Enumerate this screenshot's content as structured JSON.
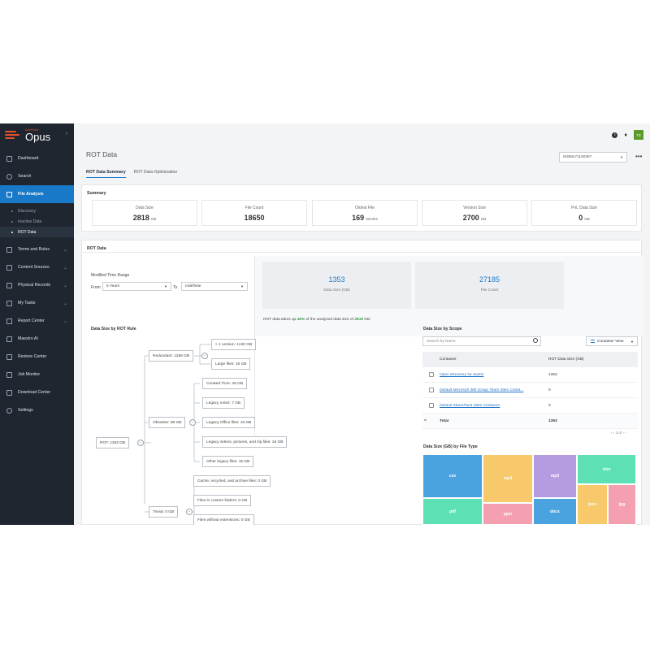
{
  "app": {
    "brand_small": "AvePoint",
    "brand_name": "Opus",
    "collapse_glyph": "‹",
    "avatar_initials": "TZ",
    "icons": [
      "info-icon",
      "bell-icon"
    ]
  },
  "sidebar": {
    "items": [
      {
        "label": "Dashboard",
        "icon": "dashboard-icon"
      },
      {
        "label": "Search",
        "icon": "search-icon"
      },
      {
        "label": "File Analysis",
        "icon": "file-analysis-icon"
      },
      {
        "label": "Terms and Rules",
        "icon": "rules-icon"
      },
      {
        "label": "Content Sources",
        "icon": "content-sources-icon"
      },
      {
        "label": "Physical Records",
        "icon": "records-icon"
      },
      {
        "label": "My Tasks",
        "icon": "tasks-icon"
      },
      {
        "label": "Report Center",
        "icon": "report-icon"
      },
      {
        "label": "Maestro AI",
        "icon": "ai-icon"
      },
      {
        "label": "Restore Center",
        "icon": "restore-icon"
      },
      {
        "label": "Job Monitor",
        "icon": "job-monitor-icon"
      },
      {
        "label": "Download Center",
        "icon": "download-icon"
      },
      {
        "label": "Settings",
        "icon": "settings-icon"
      }
    ],
    "sub_items": [
      "Discovery",
      "Inactive Data",
      "ROT Data"
    ]
  },
  "page": {
    "title": "ROT Data",
    "tenant": "M365x71180387",
    "more": "•••",
    "tabs": [
      "ROT Data Summary",
      "ROT Data Optimization"
    ]
  },
  "summary": {
    "title": "Summary",
    "boxes": [
      {
        "label": "Data Size",
        "value": "2818",
        "unit": "GB"
      },
      {
        "label": "File Count",
        "value": "18650",
        "unit": ""
      },
      {
        "label": "Oldest File",
        "value": "169",
        "unit": "Months"
      },
      {
        "label": "Version Size",
        "value": "2700",
        "unit": "GB"
      },
      {
        "label": "PnL Data Size",
        "value": "0",
        "unit": "GB"
      }
    ]
  },
  "rot": {
    "title": "ROT Data",
    "modified_label": "Modified Time Range",
    "from_label": "From",
    "from_value": "5 Years",
    "to_label": "To",
    "to_value": "Indefinite",
    "data_size_value": "1353",
    "data_size_label": "Data Size (GB)",
    "file_count_value": "27185",
    "file_count_label": "File Count",
    "note_prefix": "ROT data takes up",
    "note_percent": "48%",
    "note_middle": "of the analyzed data size of",
    "note_total": "2818",
    "note_suffix": "GB."
  },
  "rule_tree": {
    "title": "Data Size by ROT Rule",
    "root": "ROT: 1353 GB",
    "redundant": "Redundant: 1256 GB",
    "redundant_children": [
      "> 1 version: 1240 GB",
      "Large files: 16 GB"
    ],
    "obsolete": "Obsolete: 98 GB",
    "obsolete_children": [
      "Created Time: 49 GB",
      "Legacy notes: 7 GB",
      "Legacy Office files: 16 GB",
      "Legacy videos, pictures, and zip files: 16 GB",
      "Other legacy files: 15 GB"
    ],
    "trivial": "Trivial: 0 GB",
    "trivial_children": [
      "Cache, recycled, and archive files: 0 GB",
      "Files in custom folders: 0 GB",
      "Files without extensions: 0 GB"
    ]
  },
  "scope": {
    "title": "Data Size by Scope",
    "search_placeholder": "Search by Name",
    "view_label": "Container View",
    "col_container": "Container",
    "col_size": "ROT Data Size (GB)",
    "rows": [
      {
        "name": "Opus discovery for teams",
        "size": "1353"
      },
      {
        "name": "Default Microsoft 365 Group Team Sites Conta...",
        "size": "0"
      },
      {
        "name": "Default SharePoint Sites Container",
        "size": "0"
      }
    ],
    "total_label": "Total",
    "total_value": "1353",
    "pager": "‹ ‹ 1-3 › ›"
  },
  "file_type": {
    "title": "Data Size (GB) by File Type",
    "cells": [
      {
        "label": "csv",
        "color": "#4aa3df"
      },
      {
        "label": "mp4",
        "color": "#f7c96a"
      },
      {
        "label": "mp3",
        "color": "#b59be0"
      },
      {
        "label": "xlsx",
        "color": "#5ee0b5"
      },
      {
        "label": "pdf",
        "color": "#5ee0b5"
      },
      {
        "label": "pptx",
        "color": "#f5a0b0"
      },
      {
        "label": "docx",
        "color": "#4aa3df"
      },
      {
        "label": "json",
        "color": "#f7c96a"
      },
      {
        "label": "jpg",
        "color": "#f5a0b0"
      }
    ]
  }
}
